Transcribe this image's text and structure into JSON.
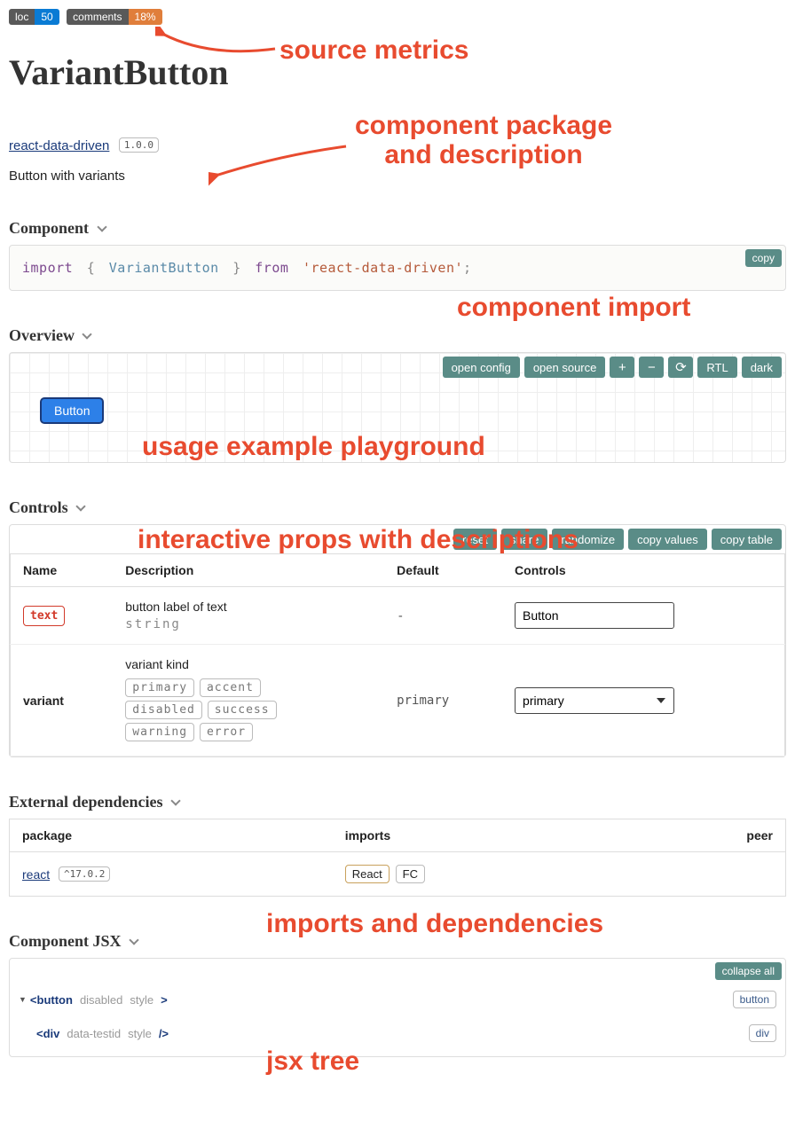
{
  "badges": {
    "loc": {
      "key": "loc",
      "value": "50"
    },
    "comments": {
      "key": "comments",
      "value": "18%"
    }
  },
  "title": "VariantButton",
  "package": {
    "name": "react-data-driven",
    "version": "1.0.0"
  },
  "description": "Button with variants",
  "sections": {
    "component": "Component",
    "overview": "Overview",
    "controls": "Controls",
    "deps": "External dependencies",
    "jsx": "Component JSX"
  },
  "import_code": {
    "kw1": "import",
    "open": "{",
    "ident": "VariantButton",
    "close": "}",
    "kw2": "from",
    "str": "'react-data-driven'",
    "semi": ";"
  },
  "copy_label": "copy",
  "playground": {
    "buttons": {
      "open_config": "open config",
      "open_source": "open source",
      "plus": "+",
      "minus": "−",
      "reset": "⟳",
      "rtl": "RTL",
      "dark": "dark"
    },
    "demo_button_label": "Button"
  },
  "controls_toolbar": {
    "reset": "reset",
    "share": "share",
    "randomize": "randomize",
    "copy_values": "copy values",
    "copy_table": "copy table"
  },
  "controls_table": {
    "headers": {
      "name": "Name",
      "desc": "Description",
      "default": "Default",
      "ctrl": "Controls"
    },
    "rows": [
      {
        "name": "text",
        "required": true,
        "desc": "button label of text",
        "type_bare": "string",
        "default": "-",
        "control_kind": "text",
        "control_value": "Button"
      },
      {
        "name": "variant",
        "required": false,
        "desc": "variant kind",
        "enum": [
          "primary",
          "accent",
          "disabled",
          "success",
          "warning",
          "error"
        ],
        "default": "primary",
        "control_kind": "select",
        "control_value": "primary"
      }
    ]
  },
  "deps_table": {
    "headers": {
      "pkg": "package",
      "imports": "imports",
      "peer": "peer"
    },
    "rows": [
      {
        "name": "react",
        "version": "^17.0.2",
        "imports": [
          "React",
          "FC"
        ]
      }
    ]
  },
  "jsx": {
    "collapse_label": "collapse all",
    "rows": [
      {
        "tag": "button",
        "open": "<button",
        "attrs": [
          "disabled",
          "style"
        ],
        "close": ">",
        "pill": "button",
        "caret": true
      },
      {
        "tag": "div",
        "open": "<div",
        "attrs": [
          "data-testid",
          "style"
        ],
        "close": "/>",
        "pill": "div",
        "caret": false,
        "child": true
      }
    ]
  },
  "annotations": {
    "source_metrics": "source metrics",
    "pkg_desc": "component package and description",
    "comp_import": "component import",
    "playground": "usage example playground",
    "controls": "interactive props with descriptions",
    "deps": "imports and dependencies",
    "jsx": "jsx tree"
  }
}
